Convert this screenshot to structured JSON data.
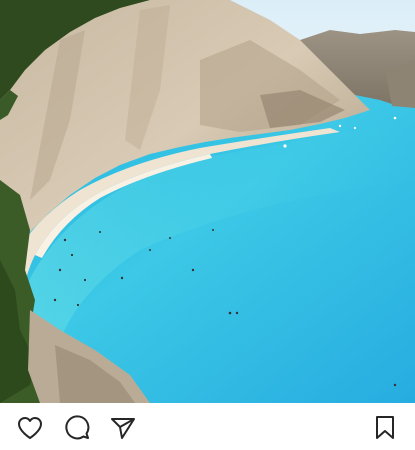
{
  "post": {
    "photo": {
      "alt": "",
      "colors": {
        "sky": "#e6f3fb",
        "sea_deep": "#1aa6d8",
        "sea_shallow": "#3fd3e6",
        "cliff": "#cdbba2",
        "cliff_shadow": "#9c8b76",
        "vegetation": "#2f4b1f",
        "beach": "#efe6d6"
      }
    },
    "actions": [
      {
        "name": "like",
        "icon": "heart-icon"
      },
      {
        "name": "comment",
        "icon": "speech-bubble-icon"
      },
      {
        "name": "share",
        "icon": "paper-plane-icon"
      },
      {
        "name": "save",
        "icon": "bookmark-icon"
      }
    ]
  }
}
